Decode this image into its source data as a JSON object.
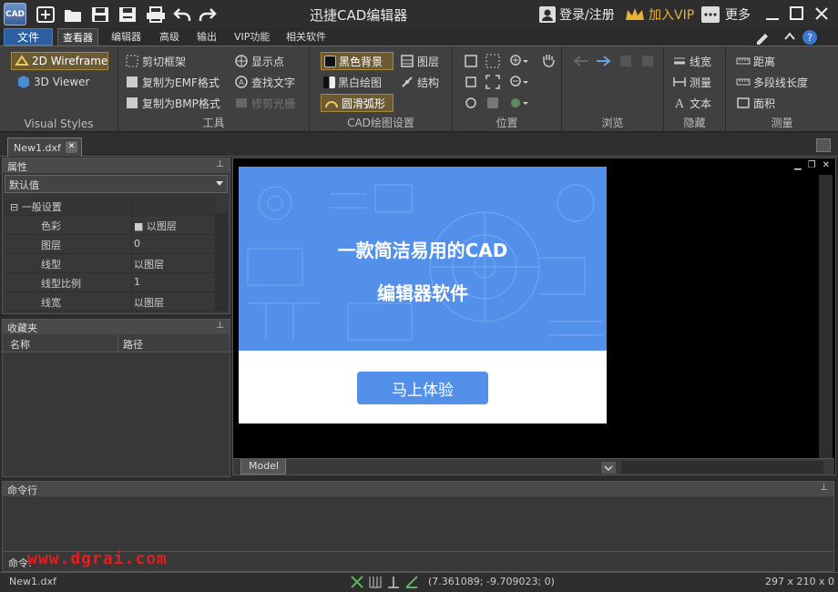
{
  "titlebar": {
    "app_icon_text": "CAD",
    "title": "迅捷CAD编辑器",
    "login": "登录/注册",
    "vip": "加入VIP",
    "more": "更多"
  },
  "menu": {
    "file": "文件",
    "tabs": [
      "查看器",
      "编辑器",
      "高级",
      "输出",
      "VIP功能",
      "相关软件"
    ]
  },
  "ribbon": {
    "visual_styles": {
      "label": "Visual Styles",
      "items": [
        "2D Wireframe",
        "3D Viewer"
      ]
    },
    "tools": {
      "label": "工具",
      "items": [
        "剪切框架",
        "复制为EMF格式",
        "复制为BMP格式",
        "显示点",
        "查找文字",
        "修剪光栅"
      ]
    },
    "cad_settings": {
      "label": "CAD绘图设置",
      "items": [
        "黑色背景",
        "黑白绘图",
        "圆滑弧形",
        "图层",
        "结构"
      ]
    },
    "position": {
      "label": "位置"
    },
    "browse": {
      "label": "浏览"
    },
    "hide": {
      "label": "隐藏",
      "items": [
        "线宽",
        "测量",
        "文本"
      ]
    },
    "measure": {
      "label": "测量",
      "items": [
        "距离",
        "多段线长度",
        "面积"
      ]
    }
  },
  "document": {
    "tab": "New1.dxf"
  },
  "properties": {
    "title": "属性",
    "selector": "默认值",
    "section": "一般设置",
    "rows": [
      {
        "key": "色彩",
        "value": "■ 以图层"
      },
      {
        "key": "图层",
        "value": "0"
      },
      {
        "key": "线型",
        "value": "以图层"
      },
      {
        "key": "线型比例",
        "value": "1"
      },
      {
        "key": "线宽",
        "value": "以图层"
      }
    ]
  },
  "favorites": {
    "title": "收藏夹",
    "col_name": "名称",
    "col_path": "路径"
  },
  "canvas": {
    "model_tab": "Model"
  },
  "promo": {
    "line1": "一款简洁易用的CAD",
    "line2": "编辑器软件",
    "button": "马上体验"
  },
  "command": {
    "title": "命令行",
    "prompt": "命令:"
  },
  "watermark": "www.dgrai.com",
  "status": {
    "file": "New1.dxf",
    "coords": "(7.361089; -9.709023; 0)",
    "paper": "297 x 210 x 0"
  },
  "colors": {
    "accent": "#2c5ea2",
    "promo_blue": "#5390ea",
    "vip_gold": "#e8b13a",
    "watermark_red": "#e02020"
  }
}
